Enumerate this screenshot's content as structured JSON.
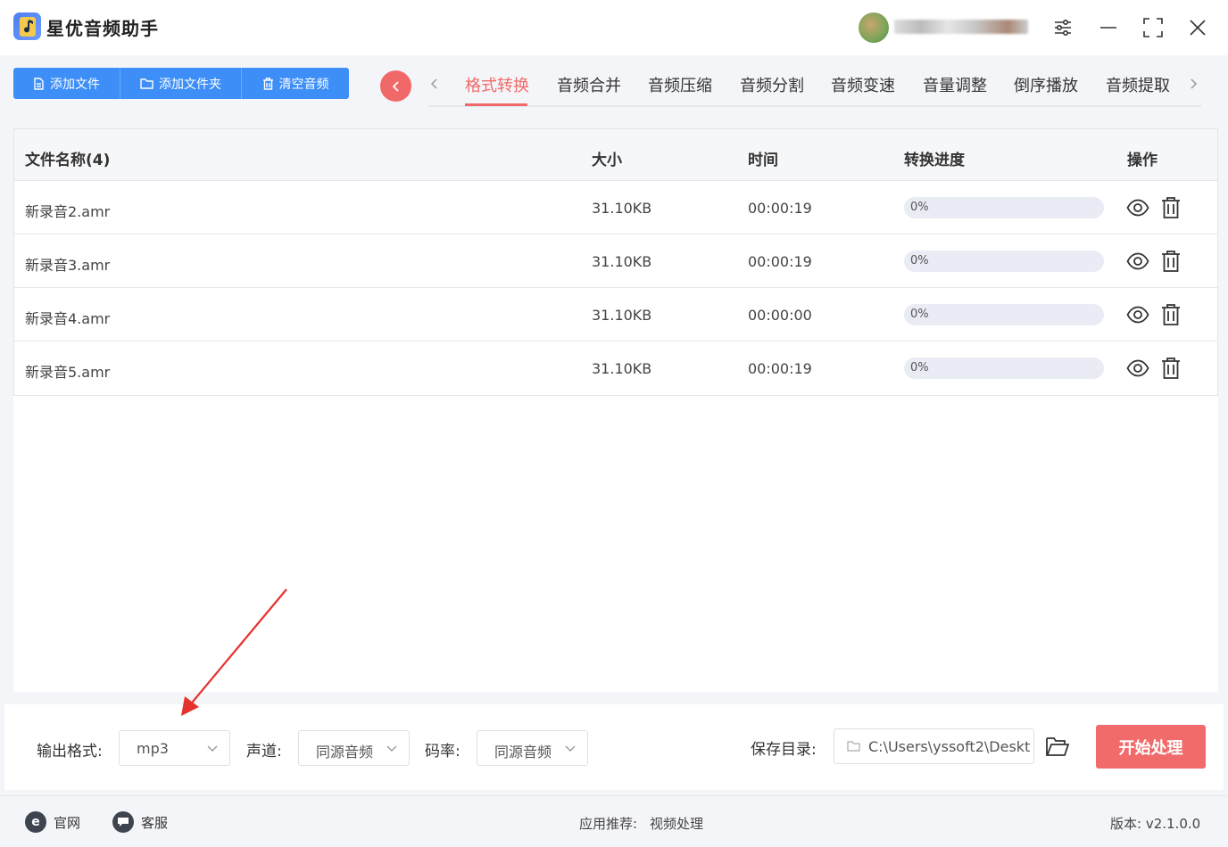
{
  "app": {
    "title": "星优音频助手"
  },
  "toolbar": {
    "add_file": "添加文件",
    "add_folder": "添加文件夹",
    "clear_audio": "清空音频"
  },
  "tabs": [
    {
      "label": "格式转换",
      "active": true
    },
    {
      "label": "音频合并"
    },
    {
      "label": "音频压缩"
    },
    {
      "label": "音频分割"
    },
    {
      "label": "音频变速"
    },
    {
      "label": "音量调整"
    },
    {
      "label": "倒序播放"
    },
    {
      "label": "音频提取"
    }
  ],
  "table": {
    "headers": {
      "name": "文件名称(4)",
      "size": "大小",
      "time": "时间",
      "progress": "转换进度",
      "actions": "操作"
    },
    "rows": [
      {
        "name": "新录音2.amr",
        "size": "31.10KB",
        "time": "00:00:19",
        "progress": "0%",
        "progress_value": 0
      },
      {
        "name": "新录音3.amr",
        "size": "31.10KB",
        "time": "00:00:19",
        "progress": "0%",
        "progress_value": 0
      },
      {
        "name": "新录音4.amr",
        "size": "31.10KB",
        "time": "00:00:00",
        "progress": "0%",
        "progress_value": 0
      },
      {
        "name": "新录音5.amr",
        "size": "31.10KB",
        "time": "00:00:19",
        "progress": "0%",
        "progress_value": 0
      }
    ]
  },
  "settings": {
    "format_label": "输出格式:",
    "format_value": "mp3",
    "channel_label": "声道:",
    "channel_value": "同源音频",
    "bitrate_label": "码率:",
    "bitrate_value": "同源音频",
    "save_label": "保存目录:",
    "save_path": "C:\\Users\\yssoft2\\Deskt",
    "start_label": "开始处理"
  },
  "footer": {
    "website": "官网",
    "support": "客服",
    "recommend": "应用推荐:",
    "recommend_app": "视频处理",
    "version": "版本:  v2.1.0.0"
  },
  "colors": {
    "primary": "#3d8ef7",
    "accent": "#f16b6b",
    "active_tab": "#ef6a6a"
  },
  "icons": [
    "music-note-icon",
    "settings-sliders-icon",
    "minimize-icon",
    "maximize-icon",
    "close-icon",
    "document-icon",
    "folder-icon",
    "trash-icon",
    "back-icon",
    "chevron-left-icon",
    "chevron-right-icon",
    "eye-icon",
    "chevron-down-icon",
    "folder-open-icon",
    "ie-icon",
    "chat-icon"
  ]
}
